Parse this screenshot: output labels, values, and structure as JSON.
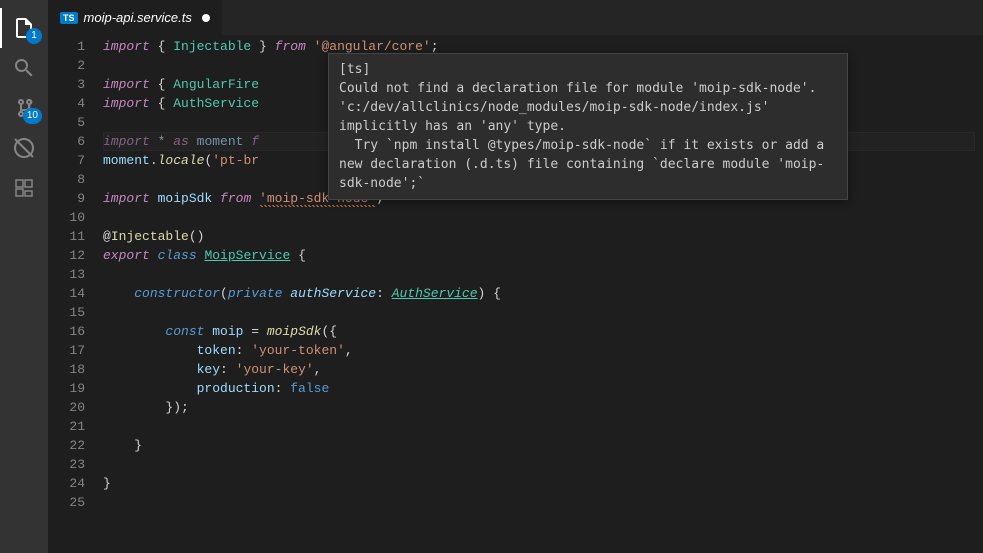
{
  "activityBar": {
    "explorerBadge": "1",
    "scmBadge": "10"
  },
  "tab": {
    "icon": "TS",
    "title": "moip-api.service.ts"
  },
  "hover": {
    "text": "[ts]\nCould not find a declaration file for module 'moip-sdk-node'. 'c:/dev/allclinics/node_modules/moip-sdk-node/index.js' implicitly has an 'any' type.\n  Try `npm install @types/moip-sdk-node` if it exists or add a new declaration (.d.ts) file containing `declare module 'moip-sdk-node';`"
  },
  "gutter": {
    "start": 1,
    "end": 25
  },
  "code": {
    "l1": {
      "a": "import",
      "b": " { ",
      "c": "Injectable",
      "d": " } ",
      "e": "from",
      "f": " ",
      "g": "'@angular/core'",
      "h": ";"
    },
    "l3": {
      "a": "import",
      "b": " { ",
      "c": "AngularFire",
      "rest": ""
    },
    "l4": {
      "a": "import",
      "b": " { ",
      "c": "AuthService",
      "rest": ""
    },
    "l6": {
      "a": "import",
      "b": " * ",
      "c": "as",
      "d": " ",
      "e": "moment",
      "f": " f"
    },
    "l7": {
      "a": "moment",
      "b": ".",
      "c": "locale",
      "d": "(",
      "e": "'pt-br"
    },
    "l9": {
      "a": "import",
      "b": " ",
      "c": "moipSdk",
      "d": " ",
      "e": "from",
      "f": " ",
      "g": "'moip-sdk-node'",
      "h": ";"
    },
    "l11": {
      "a": "@",
      "b": "Injectable",
      "c": "()"
    },
    "l12": {
      "a": "export",
      "b": " ",
      "c": "class",
      "d": " ",
      "e": "MoipService",
      "f": " {"
    },
    "l14": {
      "a": "    ",
      "b": "constructor",
      "c": "(",
      "d": "private",
      "e": " ",
      "f": "authService",
      "g": ": ",
      "h": "AuthService",
      "i": ") {"
    },
    "l16": {
      "a": "        ",
      "b": "const",
      "c": " ",
      "d": "moip",
      "e": " = ",
      "f": "moipSdk",
      "g": "({"
    },
    "l17": {
      "a": "            ",
      "b": "token",
      "c": ": ",
      "d": "'your-token'",
      "e": ","
    },
    "l18": {
      "a": "            ",
      "b": "key",
      "c": ": ",
      "d": "'your-key'",
      "e": ","
    },
    "l19": {
      "a": "            ",
      "b": "production",
      "c": ": ",
      "d": "false"
    },
    "l20": {
      "a": "        });"
    },
    "l22": {
      "a": "    }"
    },
    "l24": {
      "a": "}"
    }
  }
}
